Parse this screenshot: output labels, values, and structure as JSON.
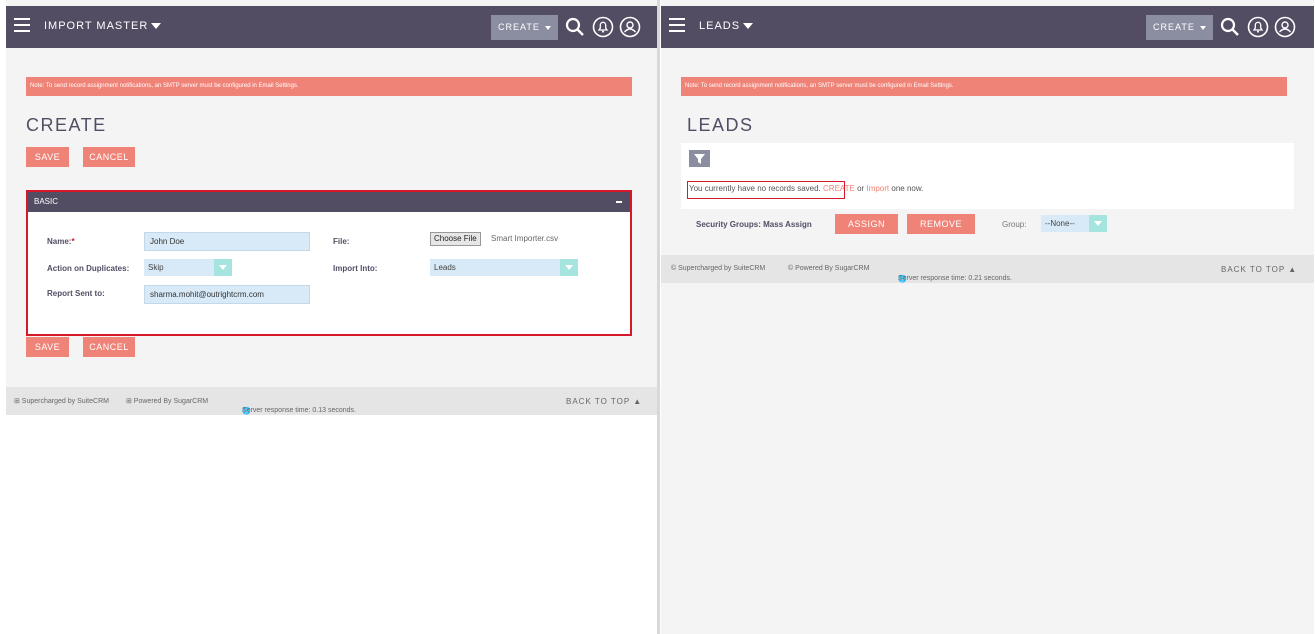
{
  "left": {
    "module": "IMPORT MASTER",
    "create_label": "CREATE",
    "notice": "Note: To send record assignment notifications, an SMTP server must be configured in Email Settings.",
    "heading": "CREATE",
    "save_label": "SAVE",
    "cancel_label": "CANCEL",
    "panel_title": "BASIC",
    "fields": {
      "name_label": "Name:",
      "name_required": "*",
      "name_value": "John Doe",
      "file_label": "File:",
      "choose_file": "Choose File",
      "file_name": "Smart Importer.csv",
      "duplicates_label": "Action on Duplicates:",
      "duplicates_value": "Skip",
      "import_into_label": "Import Into:",
      "import_into_value": "Leads",
      "report_label": "Report Sent to:",
      "report_value": "sharma.mohit@outrightcrm.com"
    },
    "footer": {
      "supercharged": "⊞ Supercharged by SuiteCRM",
      "powered": "⊞ Powered By SugarCRM",
      "response": "Server response time: 0.13 seconds.",
      "back_to_top": "BACK TO TOP ▲"
    }
  },
  "right": {
    "module": "LEADS",
    "create_label": "CREATE",
    "notice": "Note: To send record assignment notifications, an SMTP server must be configured in Email Settings.",
    "heading": "LEADS",
    "no_records": "You currently have no records saved.",
    "create_link": "CREATE",
    "or_text": "or",
    "import_link": "Import",
    "one_now": "one now.",
    "security_label": "Security Groups: Mass Assign",
    "assign_label": "ASSIGN",
    "remove_label": "REMOVE",
    "group_label": "Group:",
    "group_value": "--None--",
    "footer": {
      "supercharged": "© Supercharged by SuiteCRM",
      "powered": "© Powered By SugarCRM",
      "response": "Server response time: 0.21 seconds.",
      "back_to_top": "BACK TO TOP ▲"
    }
  },
  "colors": {
    "navbar": "#534d64",
    "accent": "#f08377",
    "highlight": "#d7182a",
    "select_arrow": "#a5e4df"
  }
}
